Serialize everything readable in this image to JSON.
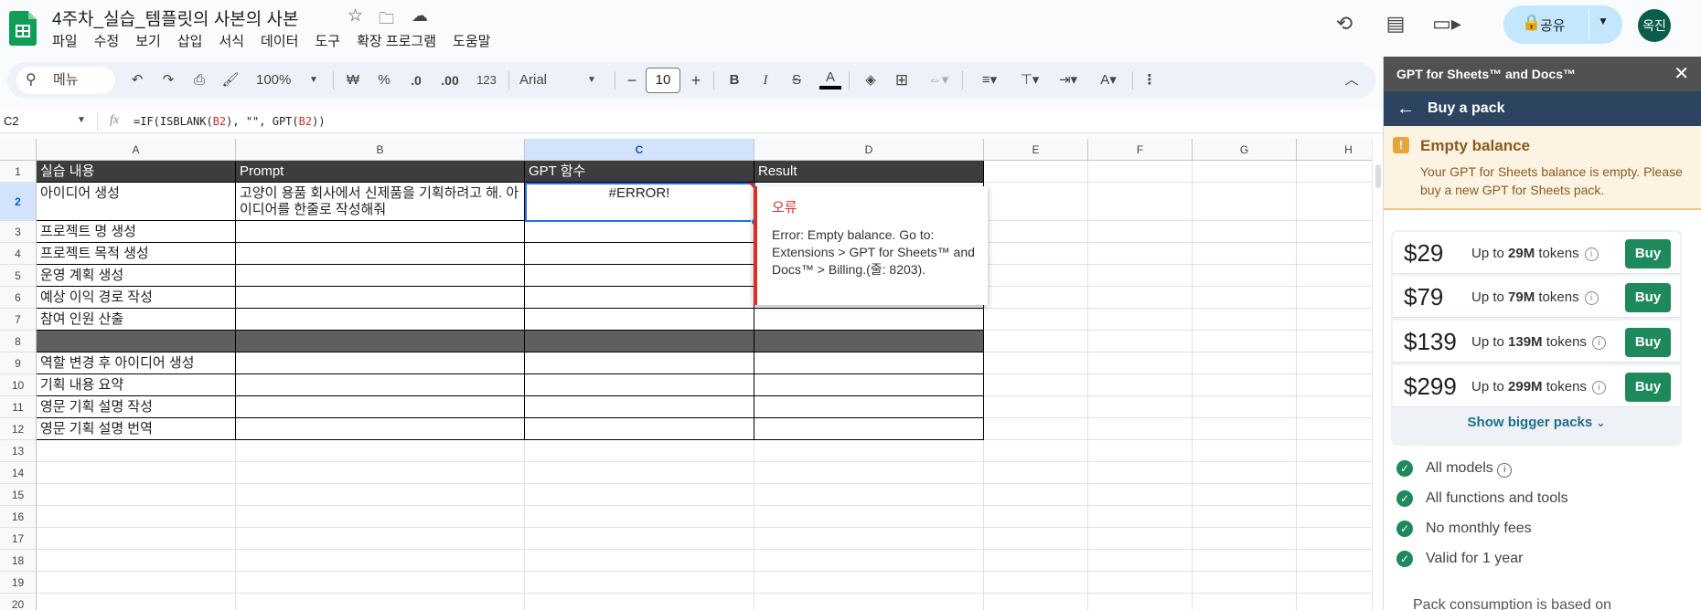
{
  "doc": {
    "title": "4주차_실습_템플릿의 사본의 사본"
  },
  "menu": [
    "파일",
    "수정",
    "보기",
    "삽입",
    "서식",
    "데이터",
    "도구",
    "확장 프로그램",
    "도움말"
  ],
  "share": {
    "label": "공유"
  },
  "avatar": {
    "initials": "옥진"
  },
  "toolbar": {
    "search": "메뉴",
    "zoom": "100%",
    "currency": "₩",
    "percent": "%",
    "dec_less": ".0",
    "dec_more": ".00",
    "number_format": "123",
    "font": "Arial",
    "font_size": "10"
  },
  "formula_bar": {
    "cell_ref": "C2",
    "formula_parts": [
      "=IF(ISBLANK(",
      "B2",
      "), \"\", GPT(",
      "B2",
      "))"
    ]
  },
  "grid": {
    "columns": [
      "A",
      "B",
      "C",
      "D",
      "E",
      "F",
      "G",
      "H"
    ],
    "rows": [
      "1",
      "2",
      "3",
      "4",
      "5",
      "6",
      "7",
      "8",
      "9",
      "10",
      "11",
      "12",
      "13",
      "14",
      "15",
      "16",
      "17",
      "18",
      "19",
      "20"
    ],
    "header": [
      "실습 내용",
      "Prompt",
      "GPT 함수",
      "Result"
    ],
    "a": [
      "아이디어 생성",
      "프로젝트 명 생성",
      "프로젝트 목적 생성",
      "운영 계획 생성",
      "예상 이익 경로 작성",
      "참여 인원 산출",
      "",
      "역할 변경 후 아이디어 생성",
      "기획 내용 요약",
      "영문 기획 설명 작성",
      "영문 기획 설명 번역"
    ],
    "b2": "고양이 용품 회사에서 신제품을 기획하려고 해. 아이디어를 한줄로 작성해줘",
    "c2": "#ERROR!"
  },
  "error_popup": {
    "title": "오류",
    "message": "Error: Empty balance. Go to: Extensions > GPT for Sheets™ and Docs™ > Billing.(줄: 8203)."
  },
  "panel": {
    "title": "GPT for Sheets™ and Docs™",
    "subtitle": "Buy a pack",
    "warning_title": "Empty balance",
    "warning_msg": "Your GPT for Sheets balance is empty. Please buy a new GPT for Sheets pack.",
    "packs": [
      {
        "price": "$29",
        "pre": "Up to ",
        "tokens": "29M",
        "post": " tokens",
        "buy": "Buy"
      },
      {
        "price": "$79",
        "pre": "Up to ",
        "tokens": "79M",
        "post": " tokens",
        "buy": "Buy"
      },
      {
        "price": "$139",
        "pre": "Up to ",
        "tokens": "139M",
        "post": " tokens",
        "buy": "Buy"
      },
      {
        "price": "$299",
        "pre": "Up to ",
        "tokens": "299M",
        "post": " tokens",
        "buy": "Buy"
      }
    ],
    "bigger": "Show bigger packs",
    "features": [
      "All models",
      "All functions and tools",
      "No monthly fees",
      "Valid for 1 year"
    ],
    "consumption": "Pack consumption is based on"
  }
}
